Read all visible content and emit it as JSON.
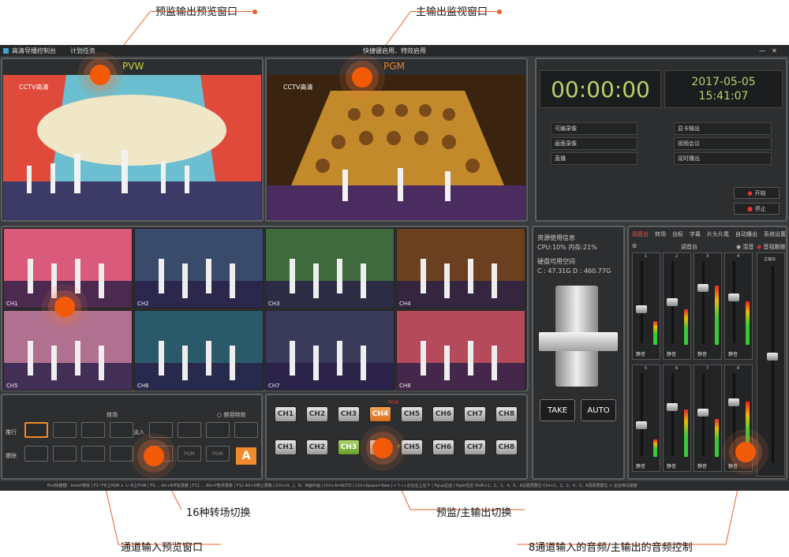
{
  "annotations": {
    "pvw_window": "预监输出预览窗口",
    "pgm_window": "主输出监视窗口",
    "transitions": "16种转场切换",
    "channel_preview": "通道输入预览窗口",
    "switch": "预监/主输出切换",
    "audio": "8通道输入的音频/主输出的音频控制"
  },
  "titlebar": {
    "app_name": "高清导播控制台",
    "menu_task": "计划任务",
    "center_text": "快捷键启用、特效启用",
    "min": "—",
    "close": "✕"
  },
  "preview": {
    "pvw_label": "PVW",
    "pgm_label": "PGM",
    "logo": "CCTV高清",
    "live_tag": "直播"
  },
  "clock": {
    "time": "00:00:00",
    "date": "2017-05-05",
    "clock": "15:41:07"
  },
  "outputs": {
    "left": [
      "可编录像",
      "画面录像",
      "直播"
    ],
    "right": [
      "显卡输出",
      "视频会议",
      "延时播出"
    ],
    "start": "开始",
    "stop": "停止"
  },
  "channels": [
    "CH1",
    "CH2",
    "CH3",
    "CH4",
    "CH5",
    "CH6",
    "CH7",
    "CH8"
  ],
  "resource": {
    "title": "资源使用信息",
    "cpu": "CPU:10% 内存:21%",
    "disk_title": "硬盘可用空间",
    "disk": "C : 47.31G D : 460.77G"
  },
  "fade": {
    "take": "TAKE",
    "auto": "AUTO"
  },
  "transition": {
    "header": "转场",
    "disable": "禁用特效",
    "row1": "推行",
    "row2": "擦除",
    "row3": "淡入",
    "pgm_key": "PGM",
    "a_key": "A",
    "fx_a": "FX",
    "fx_b": "PGM",
    "fx_c": "PGM"
  },
  "switcher": {
    "pgm_row": "PGM",
    "pvw_row": "PVW",
    "pgm_active": "CH4",
    "pvw_active": "CH3"
  },
  "audio": {
    "tabs": [
      "调音台",
      "转场",
      "台标",
      "字幕",
      "片头片尾",
      "自动播出",
      "系统设置"
    ],
    "title": "调音台",
    "mix": "混音",
    "follow": "音视跟随",
    "mute": "静音",
    "master": "主输出",
    "ch_nums": [
      "1",
      "2",
      "3",
      "4",
      "5",
      "6",
      "7",
      "8"
    ]
  },
  "statusbar": "End快捷键：Insert特效 | F1~F8上PGM + 1~8上PVW | F9 ... Alt+R开始录像 | F11 ... Alt+P暂停录像 | F12 Alt+S停止录像 | Ctrl+H，J，N，M画中画 | Ctrl+A=AUTO | Ctrl+Space=Take | ←↑→↓云台左上右下 | Pgup拉远 | Pgdn拉近 Shift+1，2，3，4，5，6设置预置位 Ctrl+1，2，3，4，5，6调看预置位 + 云台转动速度"
}
